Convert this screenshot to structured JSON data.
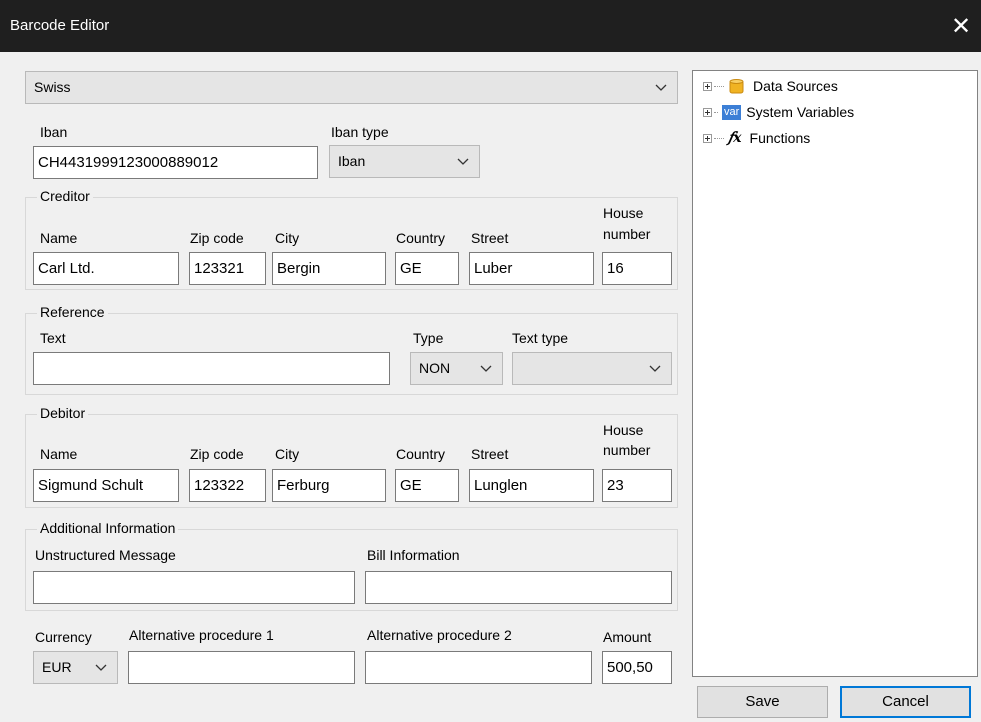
{
  "window": {
    "title": "Barcode Editor",
    "close_glyph": "✕"
  },
  "barcode_type": {
    "selected": "Swiss"
  },
  "iban": {
    "label": "Iban",
    "value": "CH4431999123000889012",
    "type_label": "Iban type",
    "type_selected": "Iban"
  },
  "creditor": {
    "title": "Creditor",
    "labels": {
      "name": "Name",
      "zip": "Zip code",
      "city": "City",
      "country": "Country",
      "street": "Street",
      "house1": "House",
      "house2": "number"
    },
    "values": {
      "name": "Carl Ltd.",
      "zip": "123321",
      "city": "Bergin",
      "country": "GE",
      "street": "Luber",
      "house": "16"
    }
  },
  "reference": {
    "title": "Reference",
    "text_label": "Text",
    "text_value": "",
    "type_label": "Type",
    "type_selected": "NON",
    "text_type_label": "Text type",
    "text_type_selected": ""
  },
  "debitor": {
    "title": "Debitor",
    "labels": {
      "name": "Name",
      "zip": "Zip code",
      "city": "City",
      "country": "Country",
      "street": "Street",
      "house1": "House",
      "house2": "number"
    },
    "values": {
      "name": "Sigmund Schult",
      "zip": "123322",
      "city": "Ferburg",
      "country": "GE",
      "street": "Lunglen",
      "house": "23"
    }
  },
  "additional": {
    "title": "Additional Information",
    "unstructured_label": "Unstructured Message",
    "unstructured_value": "",
    "bill_label": "Bill Information",
    "bill_value": ""
  },
  "bottom": {
    "currency_label": "Currency",
    "currency_selected": "EUR",
    "alt1_label": "Alternative procedure 1",
    "alt1_value": "",
    "alt2_label": "Alternative procedure 2",
    "alt2_value": "",
    "amount_label": "Amount",
    "amount_value": "500,50"
  },
  "tree": {
    "items": [
      {
        "label": "Data Sources",
        "icon": "database-icon"
      },
      {
        "label": "System Variables",
        "icon": "var-icon",
        "icon_text": "var"
      },
      {
        "label": "Functions",
        "icon": "function-icon",
        "icon_text": "fx"
      }
    ]
  },
  "buttons": {
    "save": "Save",
    "cancel": "Cancel"
  },
  "colors": {
    "titlebar": "#1f1f1f",
    "focus_border": "#0078d7",
    "var_badge": "#3c7fd6",
    "db_icon": "#f0b323"
  }
}
